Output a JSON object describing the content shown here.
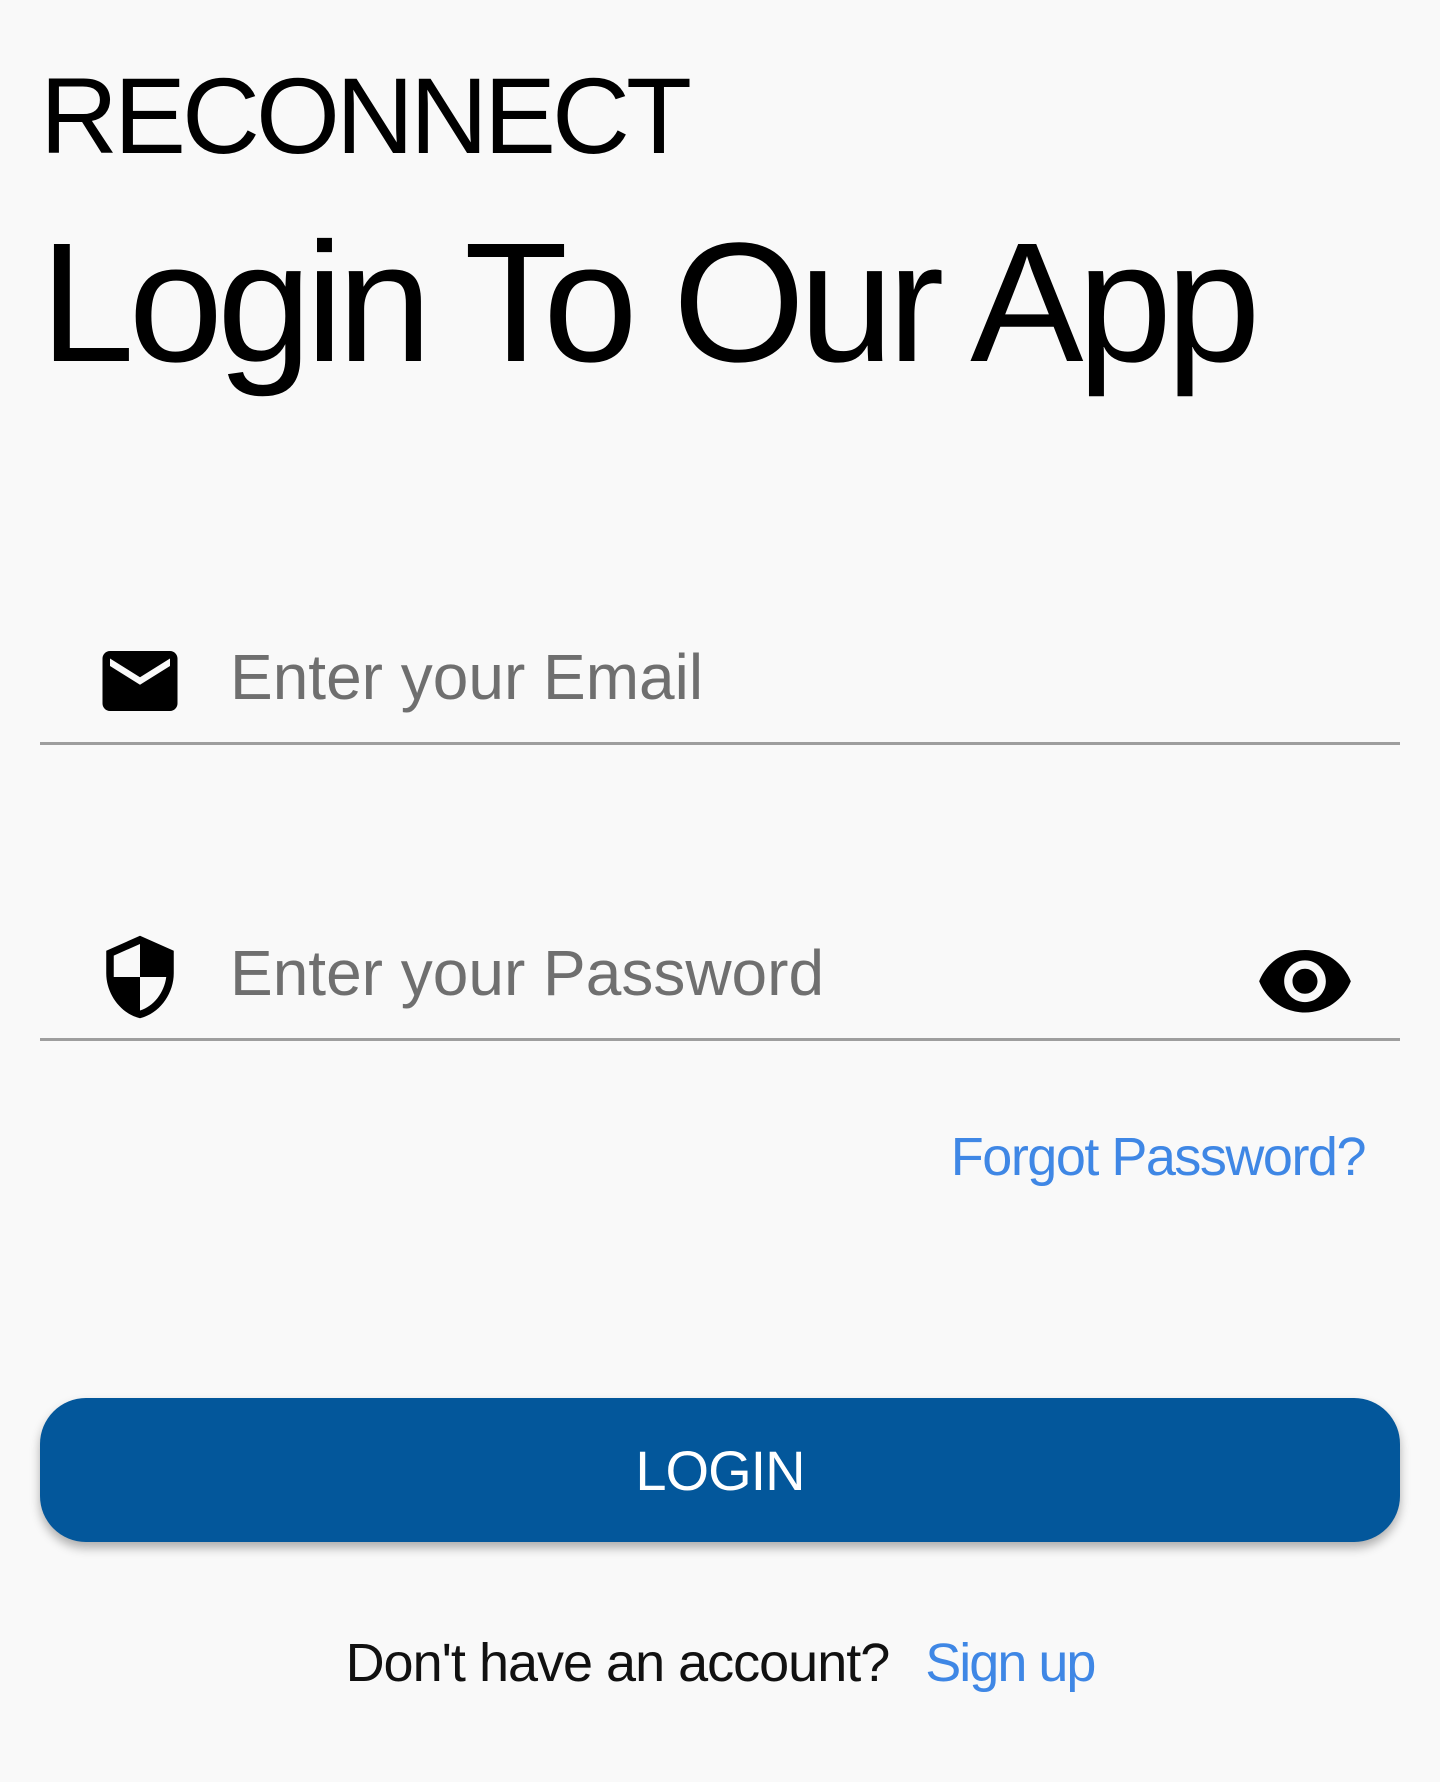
{
  "header": {
    "brand": "RECONNECT",
    "title": "Login To Our App"
  },
  "form": {
    "email": {
      "placeholder": "Enter your Email",
      "value": "",
      "icon": "mail-icon"
    },
    "password": {
      "placeholder": "Enter your Password",
      "value": "",
      "icon": "shield-icon",
      "toggle_icon": "eye-icon"
    },
    "forgot_label": "Forgot Password?",
    "login_label": "LOGIN"
  },
  "footer": {
    "prompt": "Don't have an account?",
    "signup_label": "Sign up"
  },
  "colors": {
    "background": "#f9f9f9",
    "primary_button": "#03579b",
    "link": "#3f87e5",
    "underline": "#9e9e9e",
    "placeholder": "#6f6f6f"
  }
}
